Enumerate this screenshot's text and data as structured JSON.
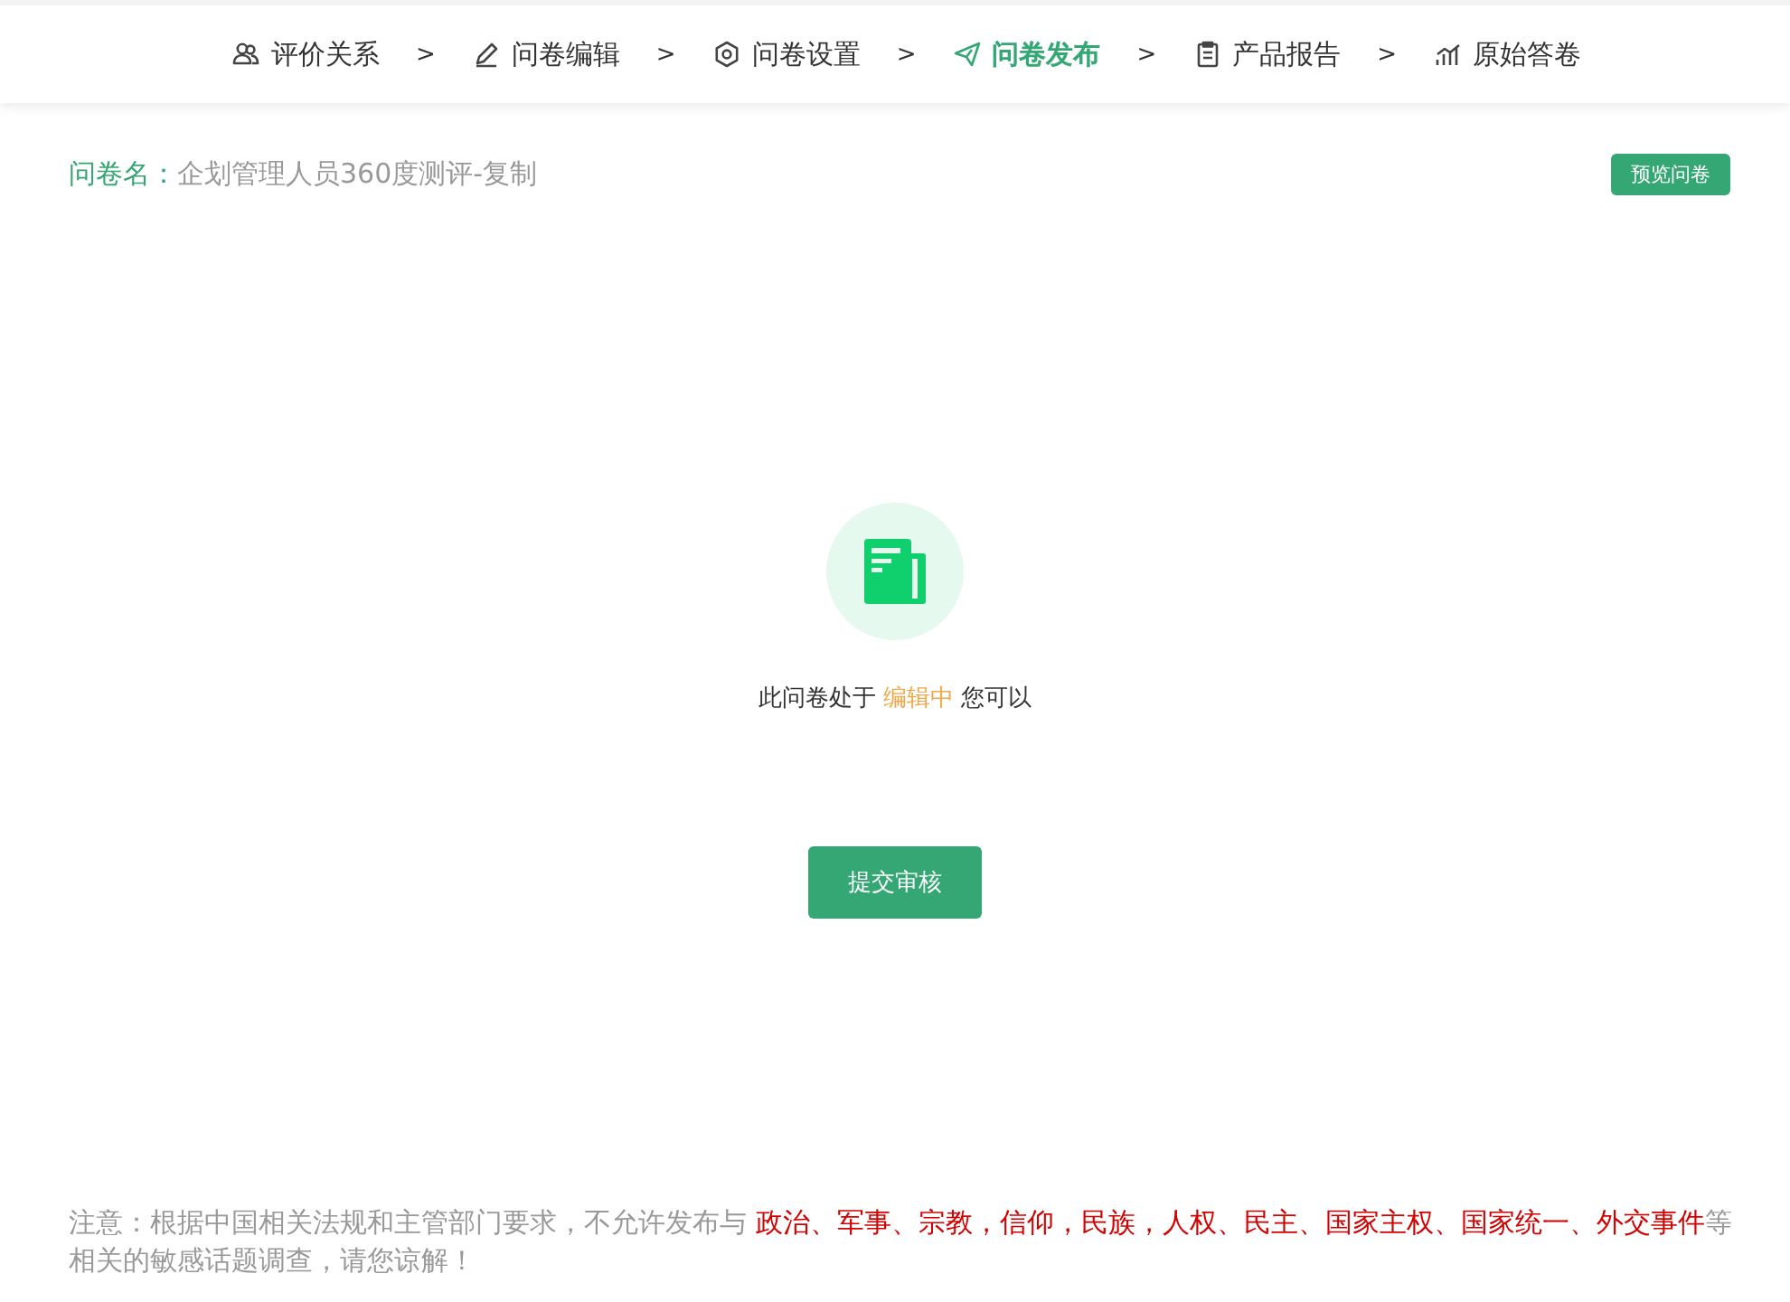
{
  "steps": [
    {
      "label": "评价关系",
      "selected": false
    },
    {
      "label": "问卷编辑",
      "selected": false
    },
    {
      "label": "问卷设置",
      "selected": false
    },
    {
      "label": "问卷发布",
      "selected": true
    },
    {
      "label": "产品报告",
      "selected": false
    },
    {
      "label": "原始答卷",
      "selected": false
    }
  ],
  "step_separators": [
    ">",
    ">",
    ">",
    ">",
    ">"
  ],
  "survey": {
    "label": "问卷名：",
    "name": "企划管理人员360度测评-复制"
  },
  "preview_button": "预览问卷",
  "status_text": [
    {
      "text": "此问卷处于 ",
      "highlight": false
    },
    {
      "text": "编辑中",
      "highlight": true
    },
    {
      "text": " 您可以",
      "highlight": false
    }
  ],
  "submit_button": "提交审核",
  "notice": [
    {
      "text": "注意：根据中国相关法规和主管部门要求，不允许发布与 ",
      "highlight": false
    },
    {
      "text": "政治、军事、宗教，信仰，民族，人权、民主、国家主权、国家统一、外交事件",
      "highlight": true
    },
    {
      "text": "等相关的敏感话题调查，请您谅解！",
      "highlight": false
    }
  ]
}
